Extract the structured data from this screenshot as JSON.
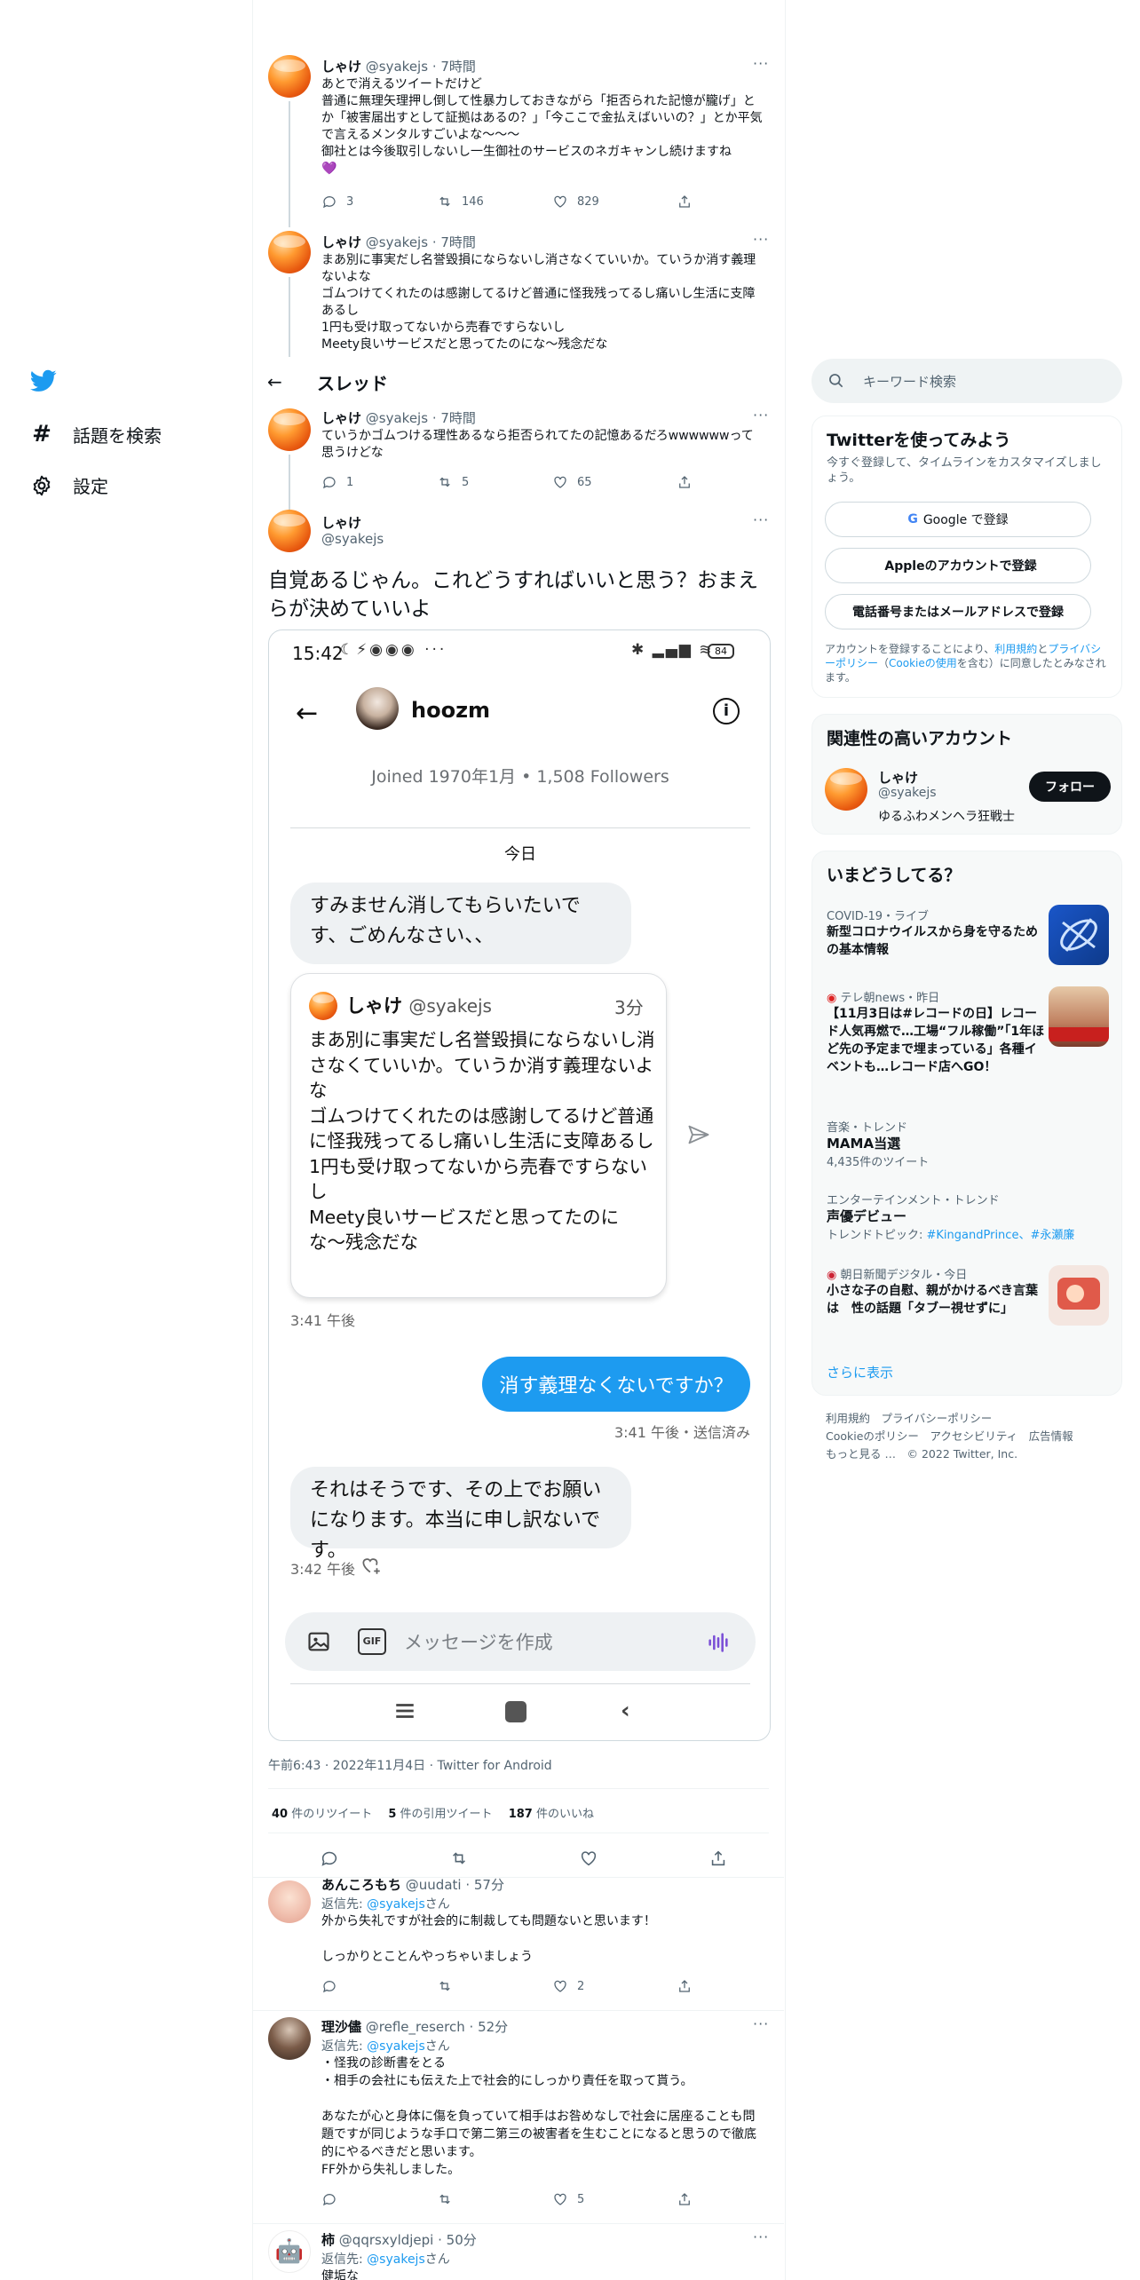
{
  "nav": {
    "topics": "話題を検索",
    "settings": "設定"
  },
  "header": {
    "title": "スレッド"
  },
  "tweets_above": [
    {
      "name": "しゃけ",
      "handle": "@syakejs",
      "time": "7時間",
      "text": "あとで消えるツイートだけど\n普通に無理矢理押し倒して性暴力しておきながら「拒否られた記憶が朧げ」とか「被害届出すとして証拠はあるの？」「今ここで金払えばいいの？」とか平気で言えるメンタルすごいよな〜〜〜\n御社とは今後取引しないし一生御社のサービスのネガキャンし続けますね\n💜",
      "replies": "3",
      "retweets": "146",
      "likes": "829"
    },
    {
      "name": "しゃけ",
      "handle": "@syakejs",
      "time": "7時間",
      "text": "まあ別に事実だし名誉毀損にならないし消さなくていいか。ていうか消す義理ないよな\nゴムつけてくれたのは感謝してるけど普通に怪我残ってるし痛いし生活に支障あるし\n1円も受け取ってないから売春ですらないし\nMeety良いサービスだと思ってたのにな〜残念だな"
    },
    {
      "name": "しゃけ",
      "handle": "@syakejs",
      "time": "7時間",
      "text": "ていうかゴムつける理性あるなら拒否られてたの記憶あるだろwwwwwwって思うけどな",
      "replies": "1",
      "retweets": "5",
      "likes": "65"
    }
  ],
  "main": {
    "name": "しゃけ",
    "handle": "@syakejs",
    "text": "自覚あるじゃん。これどうすればいいと思う？おまえらが決めていいよ",
    "footer": "午前6:43 · 2022年11月4日 · Twitter for Android",
    "retweets": "40",
    "retweets_label": " 件のリツイート",
    "quotes": "5",
    "quotes_label": " 件の引用ツイート",
    "likes": "187",
    "likes_label": " 件のいいね"
  },
  "phone": {
    "time": "15:42",
    "battery": "84",
    "contact": "hoozm",
    "joined": "Joined 1970年1月 • 1,508 Followers",
    "date_label": "今日",
    "msg1": "すみません消してもらいたいです、ごめんなさい、、",
    "quoted": {
      "name": "しゃけ",
      "handle": "@syakejs",
      "age": "3分",
      "text": "まあ別に事実だし名誉毀損にならないし消さなくていいか。ていうか消す義理ないよな\nゴムつけてくれたのは感謝してるけど普通に怪我残ってるし痛いし生活に支障あるし\n1円も受け取ってないから売春ですらないし\nMeety良いサービスだと思ってたのにな〜残念だな"
    },
    "time1": "3:41 午後",
    "msg2": "消す義理なくないですか？",
    "time2": "3:41 午後・送信済み",
    "msg3": "それはそうです、その上でお願いになります。本当に申し訳ないです。",
    "time3": "3:42 午後",
    "compose_placeholder": "メッセージを作成",
    "gif": "GIF"
  },
  "replies": [
    {
      "name": "あんころもち",
      "handle": "@uudati",
      "time": "57分",
      "reply_to_prefix": "返信先: ",
      "reply_to": "@syakejs",
      "reply_to_suffix": "さん",
      "text": "外から失礼ですが社会的に制裁しても問題ないと思います！\n\nしっかりとことんやっちゃいましょう",
      "likes": "2"
    },
    {
      "name": "理沙儘",
      "handle": "@refle_reserch",
      "time": "52分",
      "reply_to_prefix": "返信先: ",
      "reply_to": "@syakejs",
      "reply_to_suffix": "さん",
      "text": "・怪我の診断書をとる\n・相手の会社にも伝えた上で社会的にしっかり責任を取って貰う。\n\nあなたが心と身体に傷を負っていて相手はお咎めなしで社会に居座ることも問題ですが同じような手口で第二第三の被害者を生むことになると思うので徹底的にやるべきだと思います。\nFF外から失礼しました。",
      "likes": "5"
    },
    {
      "name": "柿",
      "handle": "@qqrsxyldjepi",
      "time": "50分",
      "reply_to_prefix": "返信先: ",
      "reply_to": "@syakejs",
      "reply_to_suffix": "さん",
      "text": "健垢な"
    }
  ],
  "sidebar": {
    "search_placeholder": "キーワード検索",
    "signup": {
      "title": "Twitterを使ってみよう",
      "desc": "今すぐ登録して、タイムラインをカスタマイズしましょう。",
      "google": "Google で登録",
      "apple": "Appleのアカウントで登録",
      "phone": "電話番号またはメールアドレスで登録",
      "terms_pre": "アカウントを登録することにより、",
      "terms_link": "利用規約",
      "terms_and": "と",
      "privacy_link": "プライバシーポリシー",
      "cookie_pre": "（",
      "cookie_link": "Cookieの使用",
      "terms_post": "を含む）に同意したとみなされます。"
    },
    "related": {
      "title": "関連性の高いアカウント",
      "name": "しゃけ",
      "handle": "@syakejs",
      "bio": "ゆるふわメンヘラ狂戦士",
      "follow": "フォロー"
    },
    "trends": {
      "title": "いまどうしてる？",
      "items": [
        {
          "cat": "COVID-19・ライブ",
          "title": "新型コロナウイルスから身を守るための基本情報"
        },
        {
          "cat": "テレ朝news・昨日",
          "title": "【11月3日は#レコードの日】レコード人気再燃で…工場“フル稼働”「1年ほど先の予定まで埋まっている」各種イベントも…レコード店へGO！"
        },
        {
          "cat": "音楽・トレンド",
          "title": "MAMA当選",
          "sub": "4,435件のツイート"
        },
        {
          "cat": "エンターテインメント・トレンド",
          "title": "声優デビュー",
          "sub_pre": "トレンドトピック: ",
          "sub_link": "#KingandPrince、#永瀬廉"
        },
        {
          "cat": "朝日新聞デジタル・今日",
          "title": "小さな子の自慰、親がかけるべき言葉は　性の話題「タブー視せずに」"
        }
      ],
      "more": "さらに表示"
    },
    "footer": {
      "l1a": "利用規約",
      "l1b": "プライバシーポリシー",
      "l2a": "Cookieのポリシー",
      "l2b": "アクセシビリティ",
      "l2c": "広告情報",
      "l3a": "もっと見る …",
      "l3b": "© 2022 Twitter, Inc."
    }
  },
  "colors": {
    "accent": "#1d9bf0",
    "text": "#0f1419",
    "muted": "#536471"
  }
}
